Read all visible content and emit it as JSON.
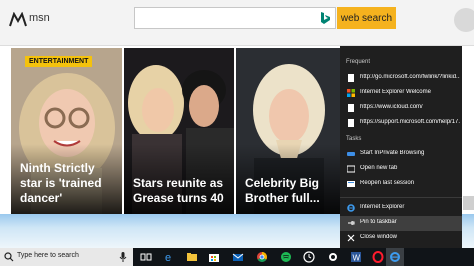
{
  "header": {
    "logo_text": "msn",
    "search_placeholder": "",
    "search_button_label": "web search"
  },
  "cards": [
    {
      "badge": "ENTERTAINMENT",
      "caption": "Ninth Strictly star is 'trained dancer'"
    },
    {
      "caption": "Stars reunite as Grease turns 40"
    },
    {
      "caption": "Celebrity Big Brother full..."
    }
  ],
  "jumplist": {
    "frequent_heading": "Frequent",
    "frequent": [
      {
        "label": "http://go.microsoft.com/fwlink/?linkid...",
        "icon": "page-icon"
      },
      {
        "label": "Internet Explorer Welcome",
        "icon": "windows-logo-icon"
      },
      {
        "label": "https://www.icloud.com/",
        "icon": "page-icon"
      },
      {
        "label": "https://support.microsoft.com/help/17...",
        "icon": "page-icon"
      }
    ],
    "tasks_heading": "Tasks",
    "tasks": [
      {
        "label": "Start InPrivate Browsing",
        "icon": "inprivate-icon"
      },
      {
        "label": "Open new tab",
        "icon": "new-tab-icon"
      },
      {
        "label": "Reopen last session",
        "icon": "reopen-session-icon"
      }
    ],
    "actions": [
      {
        "label": "Internet Explorer",
        "icon": "internet-explorer-icon"
      },
      {
        "label": "Pin to taskbar",
        "icon": "pin-icon"
      },
      {
        "label": "Close window",
        "icon": "close-icon"
      }
    ]
  },
  "taskbar": {
    "search_text": "Type here to search",
    "apps": [
      "task-view-icon",
      "edge-icon",
      "file-explorer-icon",
      "store-icon",
      "mail-icon",
      "chrome-icon",
      "spotify-icon",
      "clock-icon",
      "settings-icon",
      "word-icon",
      "opera-icon",
      "internet-explorer-icon"
    ]
  },
  "colors": {
    "search_button": "#f5b21e",
    "jumplist_bg": "#1f1f1f",
    "taskbar_bg": "#101418",
    "badge": "#f4c20d"
  }
}
